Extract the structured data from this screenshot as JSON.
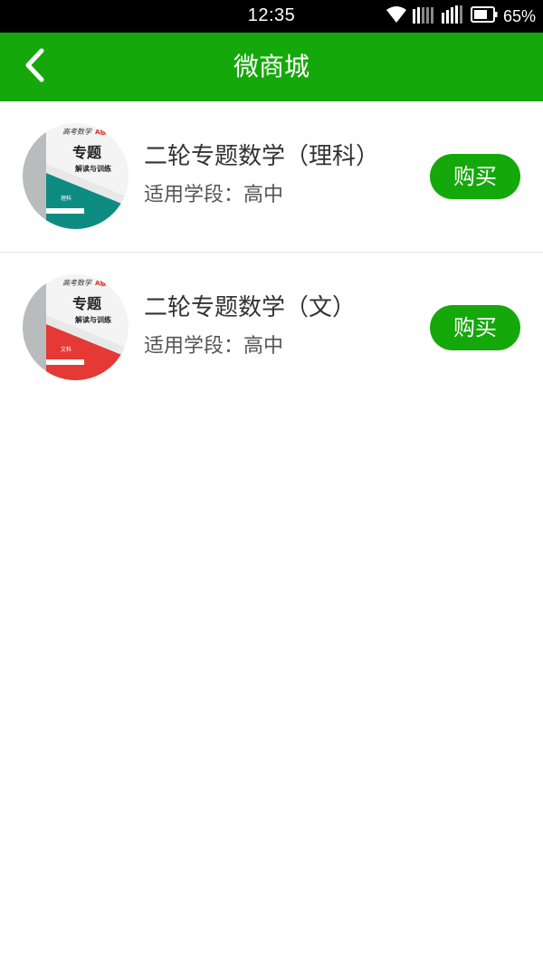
{
  "status_bar": {
    "time": "12:35",
    "battery_percent": "65%",
    "icons": [
      "wifi-icon",
      "signal-icon",
      "signal-icon",
      "battery-icon"
    ]
  },
  "header": {
    "title": "微商城",
    "back_icon": "chevron-left-icon",
    "background_color": "#15a80b"
  },
  "products": [
    {
      "title": "二轮专题数学（理科）",
      "grade": "适用学段：高中",
      "buy_label": "购买",
      "cover": {
        "series_line": "高考数学",
        "series_tag": "A版",
        "main_title": "专题",
        "subtitle": "解读与训练",
        "subject": "理科",
        "accent_color": "#0f8c82"
      }
    },
    {
      "title": "二轮专题数学（文）",
      "grade": "适用学段：高中",
      "buy_label": "购买",
      "cover": {
        "series_line": "高考数学",
        "series_tag": "A版",
        "main_title": "专题",
        "subtitle": "解读与训练",
        "subject": "文科",
        "accent_color": "#e53935"
      }
    }
  ]
}
